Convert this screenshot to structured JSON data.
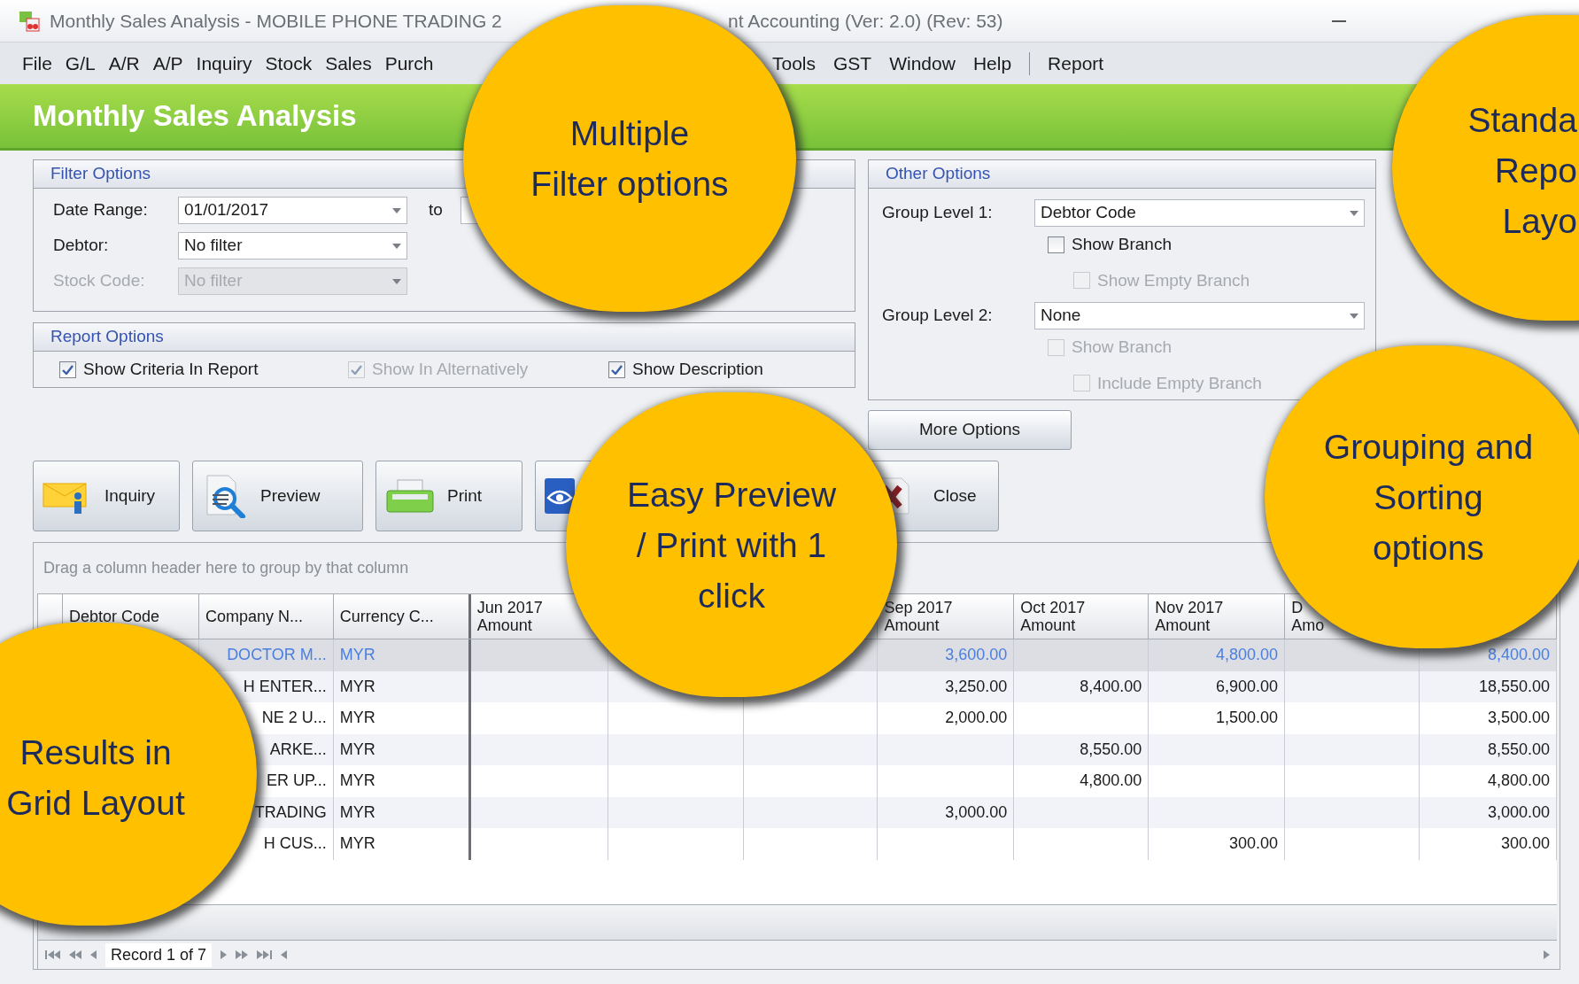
{
  "window": {
    "title_parts": [
      "Monthly Sales Analysis - MOBILE PHONE TRADING 2",
      "nt Accounting (Ver: 2.0) (Rev: 53)"
    ]
  },
  "menu": {
    "items_left": [
      "File",
      "G/L",
      "A/R",
      "A/P",
      "Inquiry",
      "Stock",
      "Sales",
      "Purch"
    ],
    "items_right": [
      "Tools",
      "GST",
      "Window",
      "Help"
    ],
    "report": "Report"
  },
  "header": {
    "title": "Monthly Sales Analysis"
  },
  "filter_options": {
    "title": "Filter Options",
    "to": "to",
    "fields": [
      {
        "label": "Date Range:",
        "value": "01/01/2017",
        "disabled": false
      },
      {
        "label": "Debtor:",
        "value": "No filter",
        "disabled": false
      },
      {
        "label": "Stock Code:",
        "value": "No filter",
        "disabled": true
      }
    ]
  },
  "report_options": {
    "title": "Report Options",
    "checkboxes": [
      {
        "label": "Show Criteria In Report",
        "checked": true,
        "disabled": false
      },
      {
        "label": "Show In Alternatively",
        "checked": true,
        "disabled": true
      },
      {
        "label": "Show Description",
        "checked": true,
        "disabled": false
      }
    ]
  },
  "other_options": {
    "title": "Other Options",
    "groups": [
      {
        "label": "Group Level 1:",
        "value": "Debtor Code",
        "checkbox": {
          "label": "Show Branch",
          "checked": false,
          "disabled": false,
          "children": [
            {
              "label": "Show Empty Branch",
              "checked": false,
              "disabled": true
            }
          ]
        }
      },
      {
        "label": "Group Level 2:",
        "value": "None",
        "checkbox": {
          "label": "Show Branch",
          "checked": false,
          "disabled": true,
          "children": [
            {
              "label": "Include Empty Branch",
              "checked": false,
              "disabled": true
            }
          ]
        }
      }
    ]
  },
  "more_options": "More Options",
  "toolbar": [
    {
      "kind": "inquiry",
      "label": "Inquiry"
    },
    {
      "kind": "preview",
      "label": "Preview"
    },
    {
      "kind": "print",
      "label": "Print"
    },
    {
      "kind": "eye"
    },
    {
      "kind": "close",
      "label": "Close"
    }
  ],
  "grid": {
    "group_hint": "Drag a column header here to group by that column",
    "columns": [
      {
        "lines": [
          "Debtor Code"
        ]
      },
      {
        "lines": [
          "Company N..."
        ]
      },
      {
        "lines": [
          "Currency C..."
        ]
      },
      {
        "lines": [
          "Jun 2017",
          "Amount"
        ]
      },
      {},
      {},
      {
        "lines": [
          "Sep 2017",
          "Amount"
        ]
      },
      {
        "lines": [
          "Oct 2017",
          "Amount"
        ]
      },
      {
        "lines": [
          "Nov 2017",
          "Amount"
        ]
      },
      {
        "lines": [
          "D",
          "Amo"
        ]
      },
      {}
    ],
    "rows": [
      {
        "selected": true,
        "cells": [
          null,
          "DOCTOR M...",
          "MYR",
          null,
          null,
          null,
          "3,600.00",
          null,
          "4,800.00",
          null,
          "8,400.00"
        ]
      },
      {
        "selected": false,
        "cells": [
          null,
          "H ENTER...",
          "MYR",
          null,
          null,
          null,
          "3,250.00",
          "8,400.00",
          "6,900.00",
          null,
          "18,550.00"
        ]
      },
      {
        "selected": false,
        "cells": [
          null,
          "NE 2 U...",
          "MYR",
          null,
          null,
          null,
          "2,000.00",
          null,
          "1,500.00",
          null,
          "3,500.00"
        ]
      },
      {
        "selected": false,
        "cells": [
          null,
          "ARKE...",
          "MYR",
          null,
          null,
          null,
          null,
          "8,550.00",
          null,
          null,
          "8,550.00"
        ]
      },
      {
        "selected": false,
        "cells": [
          null,
          "ER UP...",
          "MYR",
          null,
          null,
          null,
          null,
          "4,800.00",
          null,
          null,
          "4,800.00"
        ]
      },
      {
        "selected": false,
        "cells": [
          null,
          "TRADING",
          "MYR",
          null,
          null,
          null,
          "3,000.00",
          null,
          null,
          null,
          "3,000.00"
        ]
      },
      {
        "selected": false,
        "cells": [
          null,
          "H CUS...",
          "MYR",
          null,
          null,
          null,
          null,
          null,
          "300.00",
          null,
          "300.00"
        ]
      }
    ],
    "navigator": {
      "record": "Record 1 of 7"
    }
  },
  "callouts": [
    {
      "lines": [
        "Multiple",
        "Filter options"
      ]
    },
    {
      "lines": [
        "Standa",
        "Repo",
        "Layo"
      ]
    },
    {
      "lines": [
        "Easy Preview",
        "/ Print with 1",
        "click"
      ]
    },
    {
      "lines": [
        "Grouping and",
        "Sorting",
        "options"
      ]
    },
    {
      "lines": [
        "Results in",
        "Grid Layout"
      ]
    }
  ]
}
